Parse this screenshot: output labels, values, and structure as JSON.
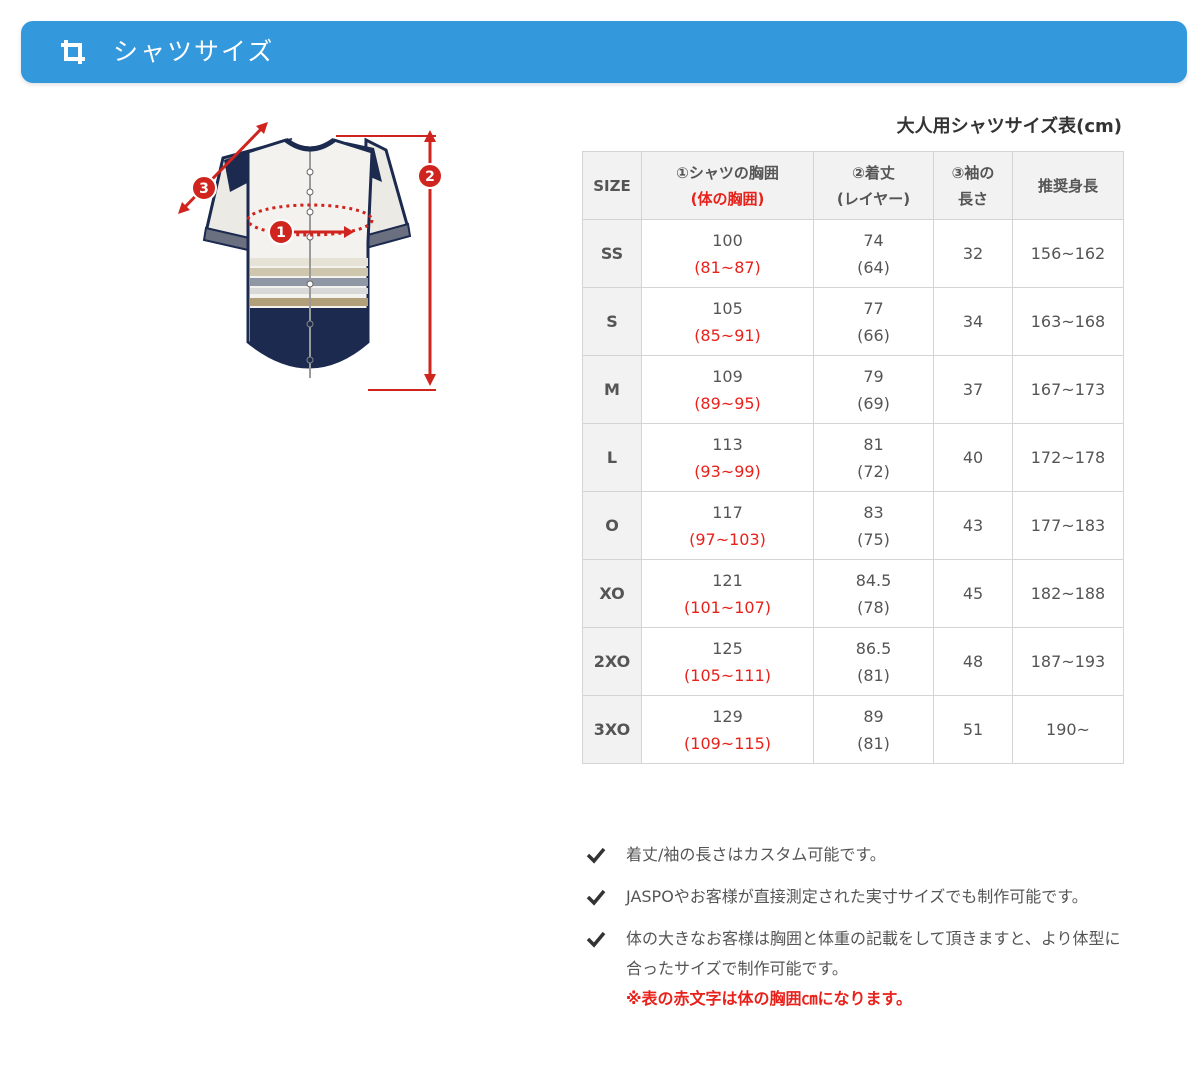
{
  "header": {
    "title": "シャツサイズ",
    "icon": "crop-icon",
    "color": "#3398dc"
  },
  "diagram": {
    "marker_1": "1",
    "marker_2": "2",
    "marker_3": "3"
  },
  "table": {
    "caption": "大人用シャツサイズ表(cm)",
    "headers": {
      "size": "SIZE",
      "chest": "①シャツの胸囲",
      "chest_sub": "(体の胸囲)",
      "length": "②着丈",
      "length_sub": "(レイヤー)",
      "sleeve": "③袖の",
      "sleeve_sub": "長さ",
      "height": "推奨身長"
    },
    "rows": [
      {
        "size": "SS",
        "chest": "100",
        "body_chest": "(81~87)",
        "length": "74",
        "layer": "(64)",
        "sleeve": "32",
        "height": "156~162"
      },
      {
        "size": "S",
        "chest": "105",
        "body_chest": "(85~91)",
        "length": "77",
        "layer": "(66)",
        "sleeve": "34",
        "height": "163~168"
      },
      {
        "size": "M",
        "chest": "109",
        "body_chest": "(89~95)",
        "length": "79",
        "layer": "(69)",
        "sleeve": "37",
        "height": "167~173"
      },
      {
        "size": "L",
        "chest": "113",
        "body_chest": "(93~99)",
        "length": "81",
        "layer": "(72)",
        "sleeve": "40",
        "height": "172~178"
      },
      {
        "size": "O",
        "chest": "117",
        "body_chest": "(97~103)",
        "length": "83",
        "layer": "(75)",
        "sleeve": "43",
        "height": "177~183"
      },
      {
        "size": "XO",
        "chest": "121",
        "body_chest": "(101~107)",
        "length": "84.5",
        "layer": "(78)",
        "sleeve": "45",
        "height": "182~188"
      },
      {
        "size": "2XO",
        "chest": "125",
        "body_chest": "(105~111)",
        "length": "86.5",
        "layer": "(81)",
        "sleeve": "48",
        "height": "187~193"
      },
      {
        "size": "3XO",
        "chest": "129",
        "body_chest": "(109~115)",
        "length": "89",
        "layer": "(81)",
        "sleeve": "51",
        "height": "190~"
      }
    ]
  },
  "notes": {
    "items": [
      {
        "icon": "check-icon",
        "text": "着丈/袖の長さはカスタム可能です。"
      },
      {
        "icon": "check-icon",
        "text": "JASPOやお客様が直接測定された実寸サイズでも制作可能です。"
      },
      {
        "icon": "check-icon",
        "text": "体の大きなお客様は胸囲と体重の記載をして頂きますと、より体型に合ったサイズで制作可能です。"
      }
    ],
    "warning": "※表の赤文字は体の胸囲㎝になります。"
  },
  "colors": {
    "accent": "#3398dc",
    "red": "#e8211b",
    "navy": "#1c2a4f",
    "tan": "#b09f78"
  }
}
